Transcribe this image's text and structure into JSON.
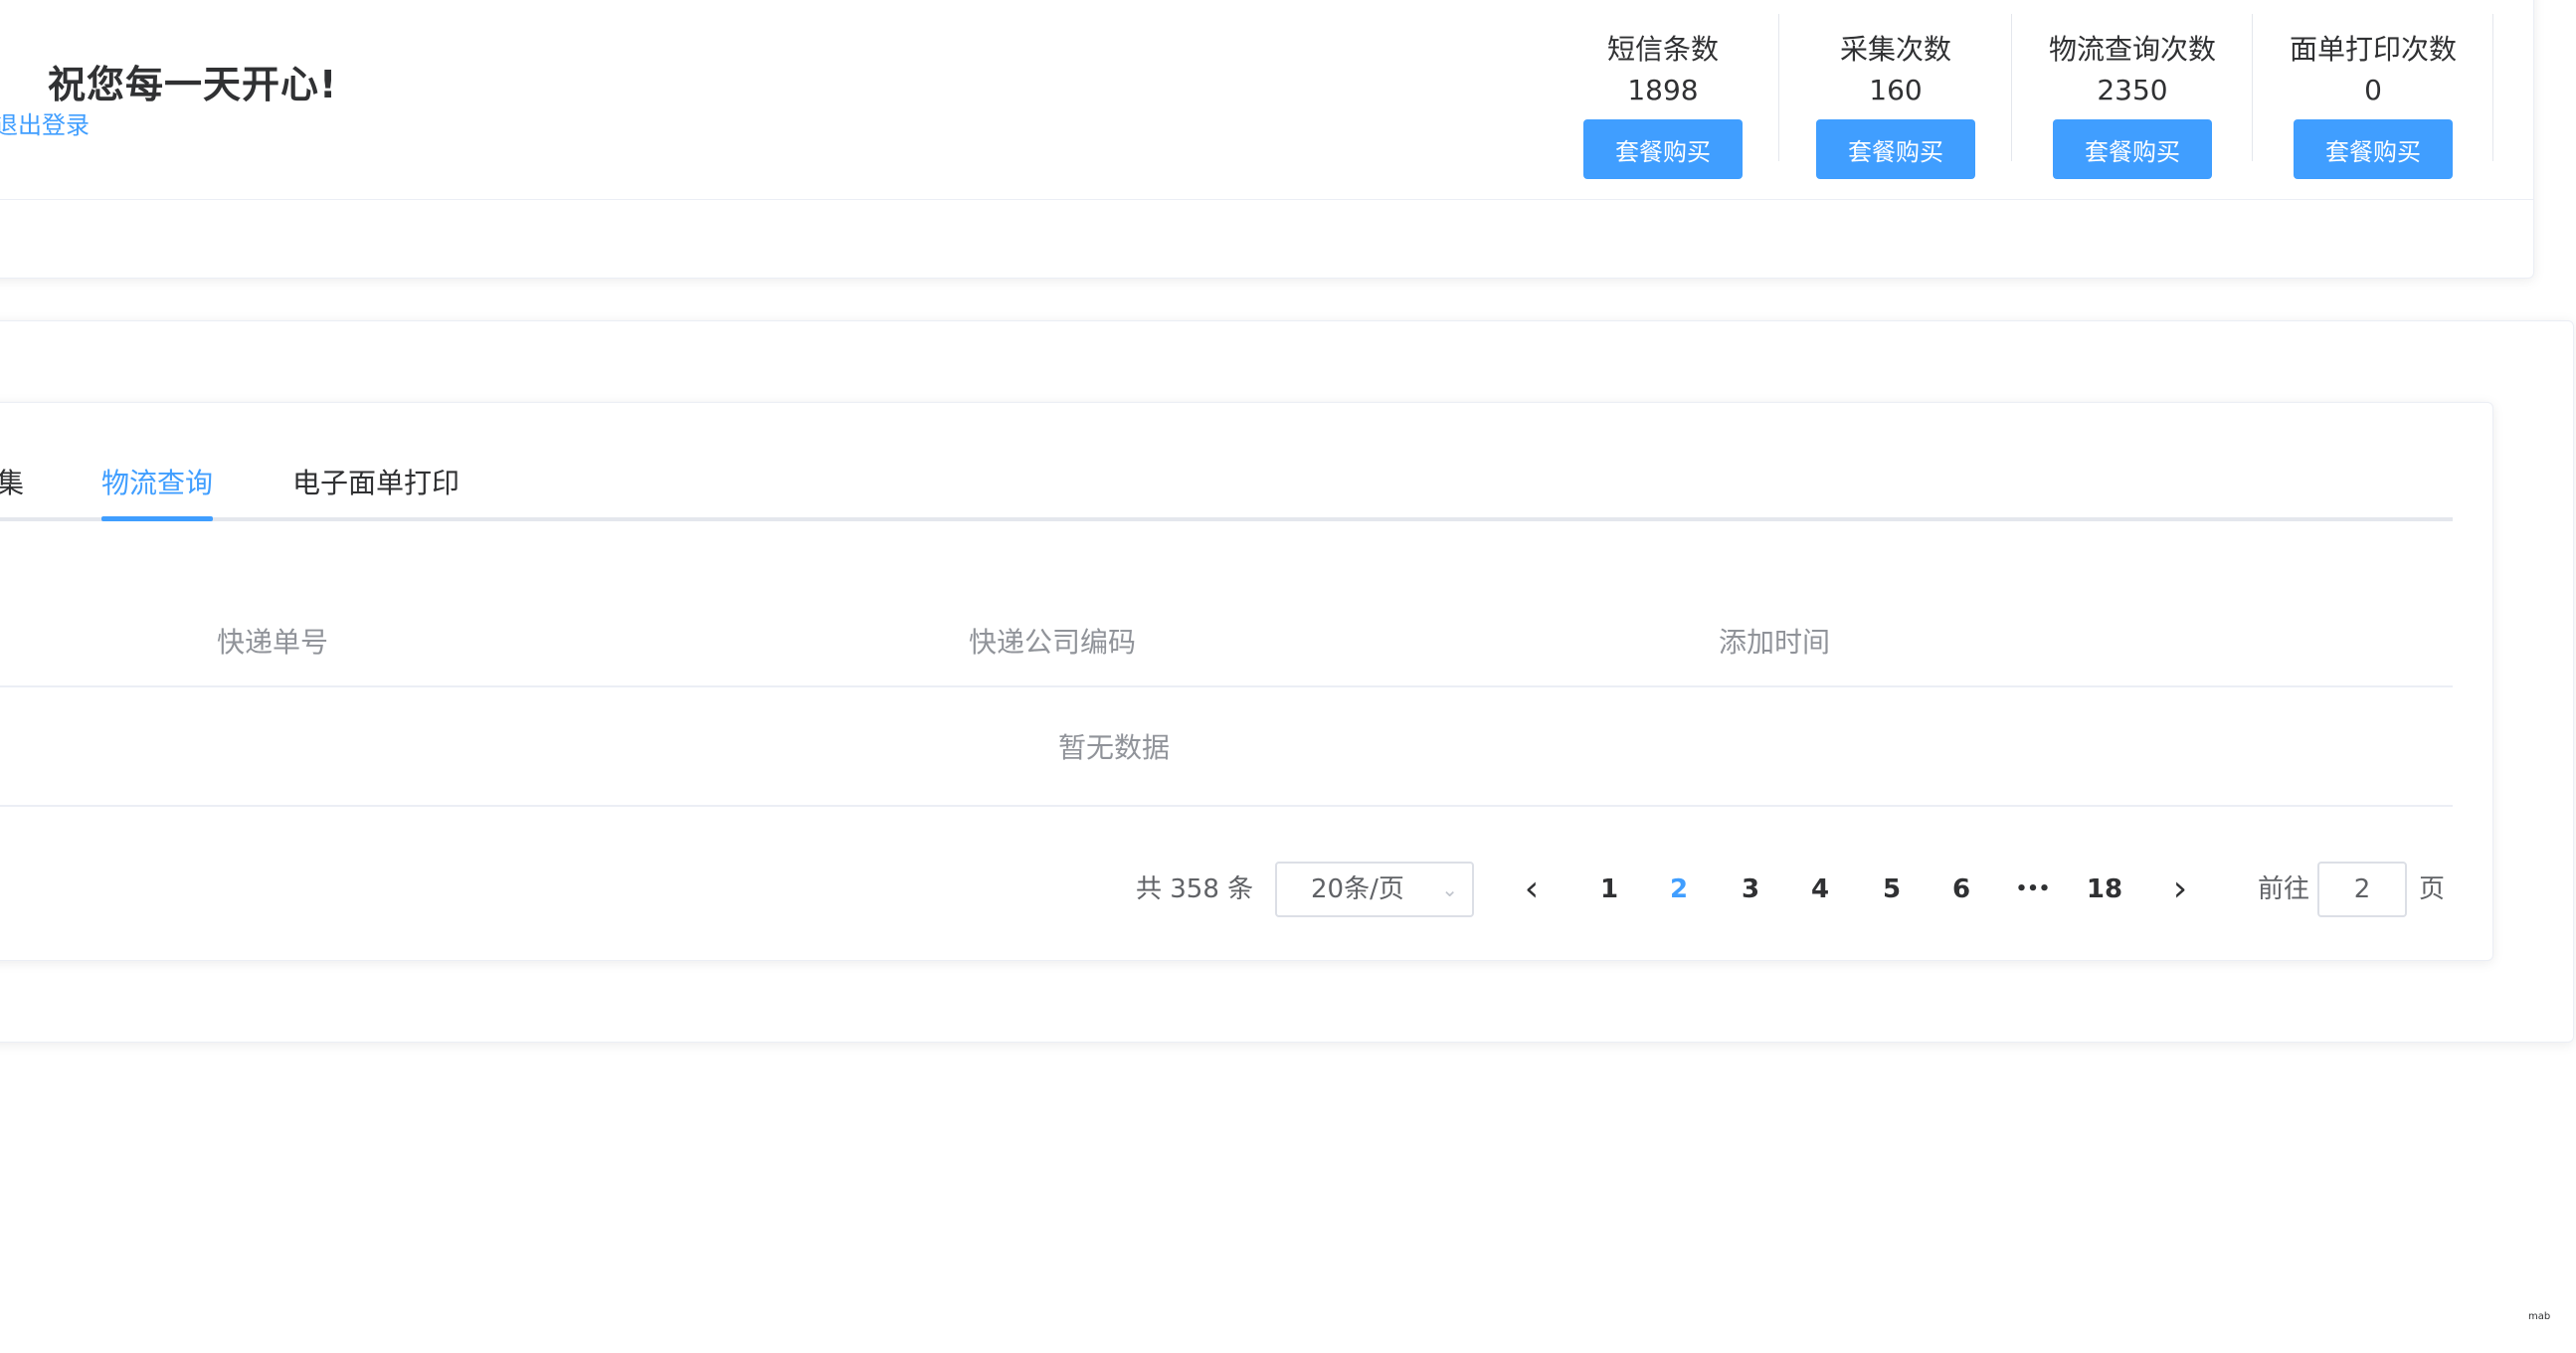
{
  "header": {
    "greeting": "祝您每一天开心!",
    "logout": "退出登录"
  },
  "stats": [
    {
      "label": "短信条数",
      "value": "1898",
      "button": "套餐购买"
    },
    {
      "label": "采集次数",
      "value": "160",
      "button": "套餐购买"
    },
    {
      "label": "物流查询次数",
      "value": "2350",
      "button": "套餐购买"
    },
    {
      "label": "面单打印次数",
      "value": "0",
      "button": "套餐购买"
    }
  ],
  "tabs": [
    {
      "label": "集",
      "active": false
    },
    {
      "label": "物流查询",
      "active": true
    },
    {
      "label": "电子面单打印",
      "active": false
    }
  ],
  "table": {
    "columns": [
      "快递单号",
      "快递公司编码",
      "添加时间"
    ],
    "empty_text": "暂无数据"
  },
  "pagination": {
    "total_text": "共 358 条",
    "page_size": "20条/页",
    "prev_icon": "‹",
    "next_icon": "›",
    "pages": [
      "1",
      "2",
      "3",
      "4",
      "5",
      "6",
      "•••",
      "18"
    ],
    "current_page": "2",
    "goto_label": "前往",
    "goto_value": "2",
    "goto_unit": "页"
  },
  "corner_mark": "mab",
  "colors": {
    "primary": "#409eff",
    "text": "#303133",
    "muted": "#909399",
    "border": "#ebeef5"
  }
}
